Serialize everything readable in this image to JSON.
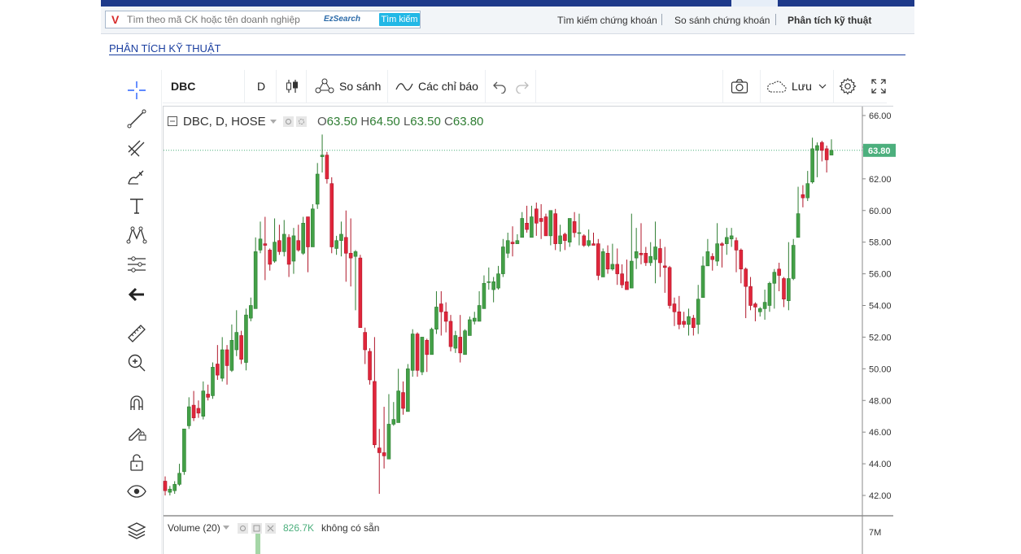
{
  "header": {
    "search_placeholder": "Tìm theo mã CK hoặc tên doanh nghiệp",
    "ezsearch_label": "EzSearch",
    "search_button": "Tìm kiếm",
    "nav": [
      "Tìm kiếm chứng khoán",
      "So sánh chứng khoán",
      "Phân tích kỹ thuật"
    ]
  },
  "page_title": "PHÂN TÍCH KỸ THUẬT",
  "toolbar": {
    "symbol": "DBC",
    "interval": "D",
    "compare": "So sánh",
    "indicators": "Các chỉ báo",
    "save": "Lưu"
  },
  "legend": {
    "title": "DBC, D, HOSE",
    "o_label": "O",
    "o_value": "63.50",
    "h_label": "H",
    "h_value": "64.50",
    "l_label": "L",
    "l_value": "63.50",
    "c_label": "C",
    "c_value": "63.80"
  },
  "volume": {
    "label": "Volume (20)",
    "value": "826.7K",
    "note": "không có sẵn",
    "axis_label": "7M"
  },
  "colors": {
    "up": "#43a047",
    "down": "#e0263b",
    "last_price_tag": "#4caf7d"
  },
  "chart_data": {
    "type": "candlestick",
    "ylim": [
      41,
      66.5
    ],
    "y_ticks": [
      "42.00",
      "44.00",
      "46.00",
      "48.00",
      "50.00",
      "52.00",
      "54.00",
      "56.00",
      "58.00",
      "60.00",
      "62.00",
      "64.00",
      "66.00"
    ],
    "last_price": 63.8,
    "last_price_label": "63.80",
    "ohlc": [
      [
        42.9,
        42.3,
        43.2,
        42.0
      ],
      [
        42.2,
        42.4,
        42.6,
        42.0
      ],
      [
        42.3,
        42.7,
        42.9,
        42.1
      ],
      [
        42.7,
        43.4,
        44.0,
        42.6
      ],
      [
        43.5,
        46.2,
        46.2,
        43.3
      ],
      [
        46.4,
        47.6,
        48.2,
        46.2
      ],
      [
        47.7,
        46.9,
        48.6,
        46.7
      ],
      [
        47.5,
        47.2,
        48.0,
        46.9
      ],
      [
        47.0,
        48.6,
        49.2,
        46.8
      ],
      [
        48.4,
        48.2,
        49.0,
        48.0
      ],
      [
        48.3,
        50.1,
        50.4,
        48.1
      ],
      [
        50.3,
        49.6,
        51.5,
        49.3
      ],
      [
        49.4,
        51.2,
        52.0,
        49.2
      ],
      [
        51.2,
        50.2,
        51.5,
        49.0
      ],
      [
        49.9,
        51.8,
        52.8,
        49.8
      ],
      [
        51.2,
        52.3,
        53.7,
        50.8
      ],
      [
        52.1,
        50.6,
        52.4,
        50.3
      ],
      [
        50.4,
        53.4,
        53.8,
        49.9
      ],
      [
        53.2,
        54.0,
        54.5,
        53.0
      ],
      [
        53.8,
        57.4,
        58.3,
        53.8
      ],
      [
        57.5,
        58.2,
        59.3,
        57.3
      ],
      [
        57.9,
        57.8,
        59.6,
        55.6
      ],
      [
        57.5,
        56.6,
        57.6,
        56.2
      ],
      [
        56.8,
        58.0,
        59.5,
        56.7
      ],
      [
        58.1,
        57.4,
        59.1,
        57.2
      ],
      [
        57.4,
        58.5,
        59.4,
        57.1
      ],
      [
        58.3,
        56.6,
        58.5,
        55.8
      ],
      [
        56.8,
        58.4,
        58.9,
        56.0
      ],
      [
        58.1,
        57.5,
        59.1,
        57.4
      ],
      [
        57.3,
        59.2,
        59.6,
        57.2
      ],
      [
        59.6,
        57.7,
        59.6,
        56.1
      ],
      [
        57.7,
        60.1,
        60.4,
        57.7
      ],
      [
        60.4,
        62.3,
        63.0,
        60.1
      ],
      [
        63.4,
        63.5,
        64.8,
        62.4
      ],
      [
        63.5,
        62.0,
        63.7,
        61.7
      ],
      [
        61.7,
        57.7,
        62.1,
        57.3
      ],
      [
        57.6,
        58.1,
        58.4,
        57.2
      ],
      [
        58.1,
        58.5,
        59.3,
        57.1
      ],
      [
        58.3,
        57.3,
        60.0,
        55.5
      ],
      [
        57.3,
        57.0,
        59.5,
        55.2
      ],
      [
        57.1,
        57.4,
        57.5,
        53.7
      ],
      [
        57.0,
        52.6,
        57.2,
        52.6
      ],
      [
        52.3,
        51.2,
        52.6,
        50.3
      ],
      [
        51.1,
        49.3,
        51.3,
        49.0
      ],
      [
        49.2,
        45.2,
        52.0,
        45.0
      ],
      [
        45.0,
        44.7,
        46.2,
        42.1
      ],
      [
        44.7,
        44.5,
        47.6,
        43.7
      ],
      [
        44.3,
        46.5,
        48.4,
        44.6
      ],
      [
        46.5,
        46.8,
        47.9,
        46.4
      ],
      [
        46.6,
        48.6,
        50.0,
        48.6
      ],
      [
        48.5,
        47.5,
        49.2,
        47.1
      ],
      [
        47.3,
        50.0,
        50.3,
        48.4
      ],
      [
        49.9,
        52.2,
        52.5,
        49.5
      ],
      [
        52.2,
        49.9,
        52.3,
        49.5
      ],
      [
        49.8,
        52.0,
        52.0,
        49.6
      ],
      [
        51.8,
        50.9,
        51.9,
        49.8
      ],
      [
        50.9,
        52.5,
        52.6,
        51.2
      ],
      [
        52.5,
        53.9,
        54.9,
        52.2
      ],
      [
        54.1,
        53.6,
        54.9,
        52.1
      ],
      [
        53.6,
        53.0,
        54.2,
        52.3
      ],
      [
        53.0,
        51.4,
        53.4,
        51.1
      ],
      [
        51.3,
        52.1,
        52.4,
        51.0
      ],
      [
        52.0,
        51.0,
        53.4,
        50.4
      ],
      [
        50.9,
        52.4,
        52.5,
        51.1
      ],
      [
        52.1,
        53.1,
        53.3,
        52.1
      ],
      [
        53.0,
        53.2,
        53.6,
        52.8
      ],
      [
        53.0,
        54.0,
        54.9,
        53.0
      ],
      [
        53.8,
        55.4,
        55.9,
        53.9
      ],
      [
        55.5,
        55.5,
        56.4,
        55.0
      ],
      [
        55.0,
        55.5,
        55.8,
        54.2
      ],
      [
        55.1,
        56.0,
        56.5,
        55.0
      ],
      [
        56.0,
        57.7,
        58.2,
        55.8
      ],
      [
        57.3,
        58.1,
        58.6,
        57.0
      ],
      [
        58.0,
        57.9,
        59.0,
        57.1
      ],
      [
        57.9,
        58.1,
        58.5,
        58.1
      ],
      [
        58.3,
        59.5,
        59.9,
        58.3
      ],
      [
        59.2,
        58.8,
        60.3,
        58.6
      ],
      [
        58.3,
        59.6,
        60.3,
        58.6
      ],
      [
        60.1,
        59.2,
        60.5,
        58.4
      ],
      [
        59.5,
        59.3,
        60.4,
        58.2
      ],
      [
        59.6,
        58.4,
        59.8,
        58.4
      ],
      [
        58.4,
        60.0,
        60.0,
        57.8
      ],
      [
        59.8,
        57.9,
        60.1,
        57.5
      ],
      [
        57.9,
        58.4,
        59.1,
        57.4
      ],
      [
        58.5,
        58.1,
        58.6,
        57.5
      ],
      [
        58.0,
        59.5,
        59.5,
        57.7
      ],
      [
        59.3,
        58.6,
        59.9,
        58.3
      ],
      [
        58.6,
        58.6,
        59.8,
        57.8
      ],
      [
        58.4,
        57.8,
        58.5,
        57.7
      ],
      [
        57.8,
        58.1,
        58.8,
        57.7
      ],
      [
        57.9,
        57.8,
        58.6,
        57.8
      ],
      [
        57.9,
        55.9,
        58.2,
        55.6
      ],
      [
        55.8,
        57.4,
        57.6,
        55.9
      ],
      [
        57.3,
        56.3,
        57.8,
        56.0
      ],
      [
        56.3,
        56.6,
        57.9,
        56.2
      ],
      [
        56.6,
        56.0,
        57.6,
        55.3
      ],
      [
        56.0,
        55.3,
        56.6,
        55.1
      ],
      [
        55.5,
        55.0,
        56.9,
        55.1
      ],
      [
        55.1,
        56.8,
        59.8,
        56.4
      ],
      [
        57.0,
        57.4,
        58.9,
        56.3
      ],
      [
        57.3,
        57.2,
        59.2,
        56.6
      ],
      [
        57.3,
        56.7,
        57.7,
        56.5
      ],
      [
        56.7,
        57.1,
        58.0,
        56.5
      ],
      [
        56.9,
        57.7,
        59.3,
        55.4
      ],
      [
        57.6,
        56.7,
        58.2,
        55.8
      ],
      [
        56.5,
        56.4,
        57.7,
        54.8
      ],
      [
        56.4,
        54.0,
        56.5,
        53.8
      ],
      [
        54.1,
        53.6,
        54.5,
        52.7
      ],
      [
        53.6,
        52.8,
        54.6,
        52.5
      ],
      [
        53.0,
        52.8,
        53.6,
        52.6
      ],
      [
        52.8,
        53.3,
        53.8,
        52.1
      ],
      [
        53.2,
        52.6,
        53.4,
        52.1
      ],
      [
        52.8,
        54.4,
        55.3,
        52.2
      ],
      [
        54.5,
        56.5,
        57.1,
        54.5
      ],
      [
        56.5,
        57.4,
        58.2,
        56.6
      ],
      [
        57.1,
        56.9,
        57.3,
        56.2
      ],
      [
        56.8,
        57.9,
        59.2,
        56.5
      ],
      [
        57.9,
        57.8,
        58.0,
        56.4
      ],
      [
        57.9,
        58.3,
        58.9,
        57.2
      ],
      [
        58.2,
        58.4,
        58.9,
        57.7
      ],
      [
        58.1,
        57.5,
        58.3,
        56.1
      ],
      [
        57.5,
        56.3,
        57.6,
        55.4
      ],
      [
        56.3,
        55.2,
        56.4,
        53.2
      ],
      [
        55.2,
        54.0,
        55.8,
        53.7
      ],
      [
        54.1,
        53.9,
        54.2,
        53.0
      ],
      [
        53.6,
        53.8,
        53.9,
        53.3
      ],
      [
        53.8,
        54.2,
        55.0,
        53.1
      ],
      [
        54.0,
        55.4,
        55.5,
        53.6
      ],
      [
        55.4,
        56.1,
        56.3,
        53.8
      ],
      [
        56.3,
        55.9,
        56.7,
        54.9
      ],
      [
        55.7,
        54.4,
        55.8,
        53.9
      ],
      [
        54.3,
        55.7,
        58.0,
        53.7
      ],
      [
        55.7,
        57.8,
        58.2,
        55.6
      ],
      [
        58.3,
        59.8,
        61.5,
        58.8
      ],
      [
        61.0,
        60.8,
        61.6,
        60.2
      ],
      [
        60.8,
        61.7,
        62.5,
        60.6
      ],
      [
        61.8,
        63.9,
        64.6,
        61.7
      ],
      [
        63.8,
        64.1,
        64.3,
        62.1
      ],
      [
        64.3,
        63.8,
        64.4,
        63.1
      ],
      [
        63.9,
        63.2,
        64.1,
        62.4
      ],
      [
        63.5,
        63.8,
        64.5,
        63.5
      ]
    ]
  }
}
